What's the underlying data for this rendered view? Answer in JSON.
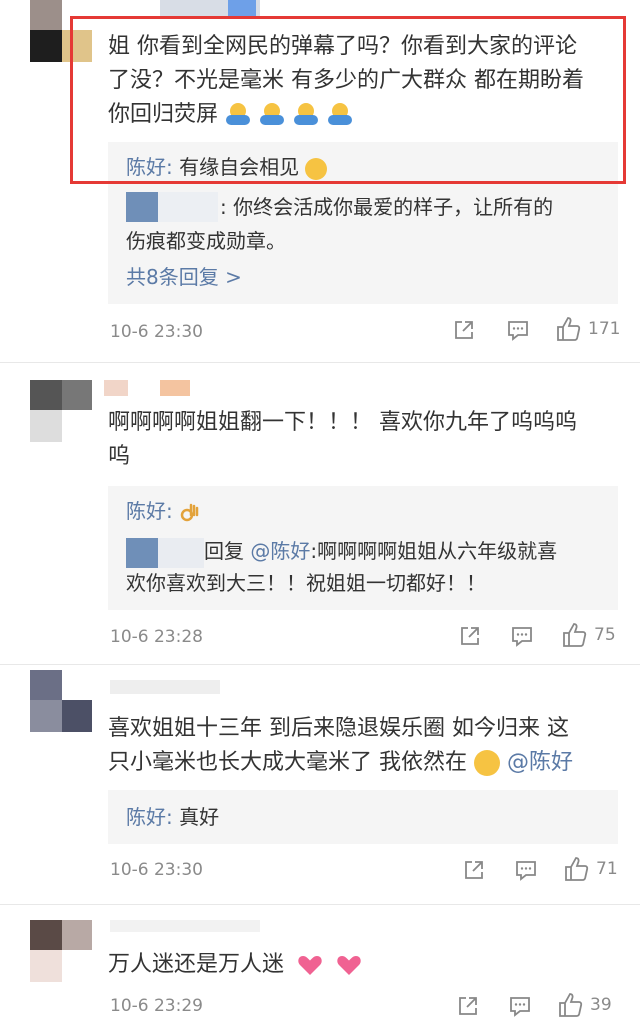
{
  "comments": [
    {
      "text_lines": [
        "姐 你看到全网民的弹幕了吗？你看到大家的评论",
        "了没？不光是毫米 有多少的广大群众 都在期盼着",
        "你回归荧屏"
      ],
      "replies": [
        {
          "name": "陈好:",
          "text": " 有缘自会相见"
        },
        {
          "name": "",
          "text": ": 你终会活成你最爱的样子，让所有的"
        },
        {
          "name": "",
          "text": "伤痕都变成勋章。"
        }
      ],
      "more_replies": "共8条回复 >",
      "time": "10-6 23:30",
      "likes": "171"
    },
    {
      "text_lines": [
        "啊啊啊啊姐姐翻一下！！！ 喜欢你九年了呜呜呜",
        "呜"
      ],
      "replies": [
        {
          "name": "陈好:",
          "text": ""
        },
        {
          "name": "",
          "text": "回复 "
        },
        {
          "name": "",
          "text": "欢你喜欢到大三！！祝姐姐一切都好！！"
        }
      ],
      "reply_mention": "@陈好",
      "reply_mention_rest": ":啊啊啊啊姐姐从六年级就喜",
      "time": "10-6 23:28",
      "likes": "75"
    },
    {
      "text_lines": [
        "喜欢姐姐十三年 到后来隐退娱乐圈 如今归来 这",
        "只小毫米也长大成大毫米了 我依然在"
      ],
      "mention": "@陈好",
      "replies": [
        {
          "name": "陈好:",
          "text": " 真好"
        }
      ],
      "time": "10-6 23:30",
      "likes": "71"
    },
    {
      "text_lines": [
        "万人迷还是万人迷"
      ],
      "time": "10-6 23:29",
      "likes": "39"
    }
  ],
  "icons": [
    "share-icon",
    "comment-icon",
    "like-icon",
    "hug-emoji-icon",
    "heart-emoji-icon",
    "ok-hand-emoji-icon"
  ],
  "colors": {
    "name": "#5b7aa6",
    "highlight": "#e53935",
    "reply_bg": "#f5f5f5",
    "meta": "#8a8a8a"
  }
}
